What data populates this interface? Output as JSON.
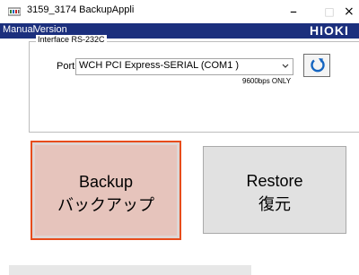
{
  "window": {
    "title": "3159_3174 BackupAppli",
    "icon": "app-icon",
    "controls": {
      "minimize": "–",
      "maximize": "□",
      "close": "×"
    }
  },
  "menu": {
    "items": [
      "Manual",
      "Version"
    ],
    "brand": "HIOKI"
  },
  "interface_group": {
    "label": "Interface RS-232C"
  },
  "port": {
    "label": "Port",
    "selected": "WCH PCI Express-SERIAL (COM1 )",
    "note": "9600bps ONLY",
    "refresh_icon": "refresh-icon"
  },
  "buttons": {
    "backup": {
      "line1": "Backup",
      "line2": "バックアップ"
    },
    "restore": {
      "line1": "Restore",
      "line2": "復元"
    }
  },
  "colors": {
    "menubar": "#1b2f7d",
    "accent": "#e74c1b",
    "refresh": "#1565c0"
  }
}
